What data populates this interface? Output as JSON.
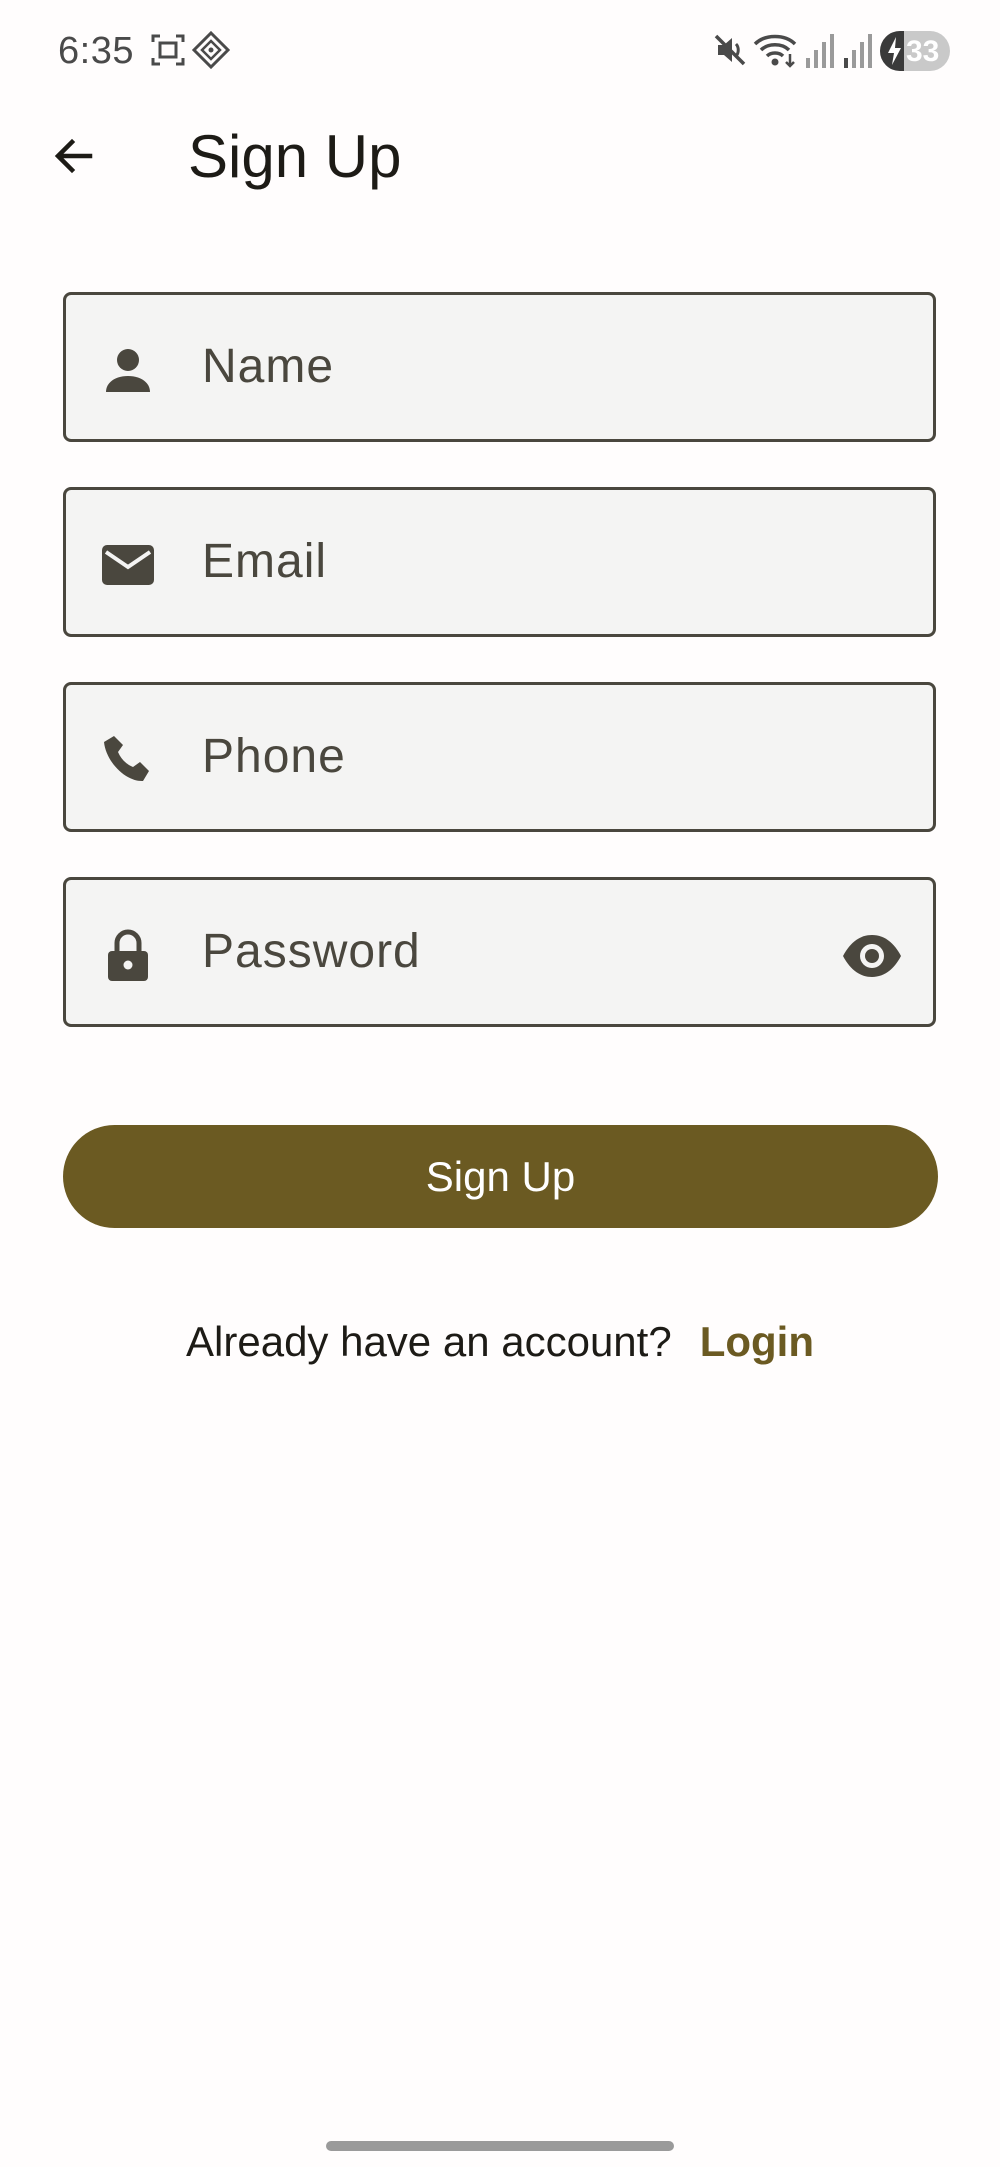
{
  "status_bar": {
    "time": "6:35",
    "battery_level": "33",
    "icons": [
      "screenshot-icon",
      "app-icon",
      "mute-icon",
      "wifi-icon",
      "signal-icon",
      "signal-icon-2",
      "battery-charging-icon"
    ]
  },
  "app_bar": {
    "title": "Sign Up",
    "back_icon": "arrow-back-icon"
  },
  "form": {
    "fields": [
      {
        "placeholder": "Name",
        "icon": "person-icon"
      },
      {
        "placeholder": "Email",
        "icon": "mail-icon"
      },
      {
        "placeholder": "Phone",
        "icon": "phone-icon"
      },
      {
        "placeholder": "Password",
        "icon": "lock-icon",
        "trailing_icon": "visibility-icon"
      }
    ],
    "submit_label": "Sign Up"
  },
  "footer": {
    "prompt": "Already have an account?",
    "login_label": "Login"
  },
  "colors": {
    "accent": "#6b5a22",
    "field_background": "#f4f4f3",
    "field_border": "#4a473e",
    "text": "#1d1b16"
  }
}
